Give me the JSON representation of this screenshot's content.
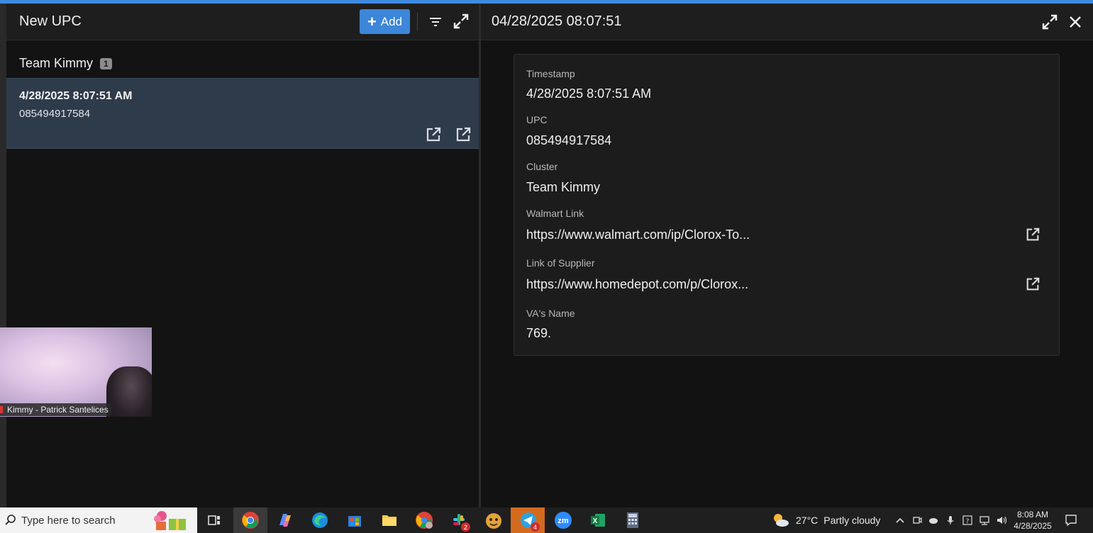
{
  "left_panel": {
    "title": "New UPC",
    "add_label": "Add",
    "group": {
      "name": "Team Kimmy",
      "count": "1"
    },
    "items": [
      {
        "timestamp": "4/28/2025 8:07:51 AM",
        "upc": "085494917584"
      }
    ]
  },
  "video_overlay": {
    "label": "Kimmy - Patrick Santelices"
  },
  "right_panel": {
    "title": "04/28/2025 08:07:51",
    "fields": {
      "timestamp": {
        "label": "Timestamp",
        "value": "4/28/2025 8:07:51 AM"
      },
      "upc": {
        "label": "UPC",
        "value": "085494917584"
      },
      "cluster": {
        "label": "Cluster",
        "value": "Team Kimmy"
      },
      "walmart": {
        "label": "Walmart Link",
        "value": "https://www.walmart.com/ip/Clorox-To..."
      },
      "supplier": {
        "label": "Link of Supplier",
        "value": "https://www.homedepot.com/p/Clorox..."
      },
      "va_name": {
        "label": "VA's Name",
        "value": "769."
      }
    }
  },
  "taskbar": {
    "search_placeholder": "Type here to search",
    "weather_temp": "27°C",
    "weather_desc": "Partly cloudy",
    "time": "8:08 AM",
    "date": "4/28/2025",
    "slack_badge": "2",
    "telegram_badge": "4",
    "zoom_text": "zm",
    "excel_text": "X"
  },
  "colors": {
    "accent": "#3d86d9",
    "selected_row": "#2e3b4a",
    "top_bar": "#3f8be0"
  }
}
